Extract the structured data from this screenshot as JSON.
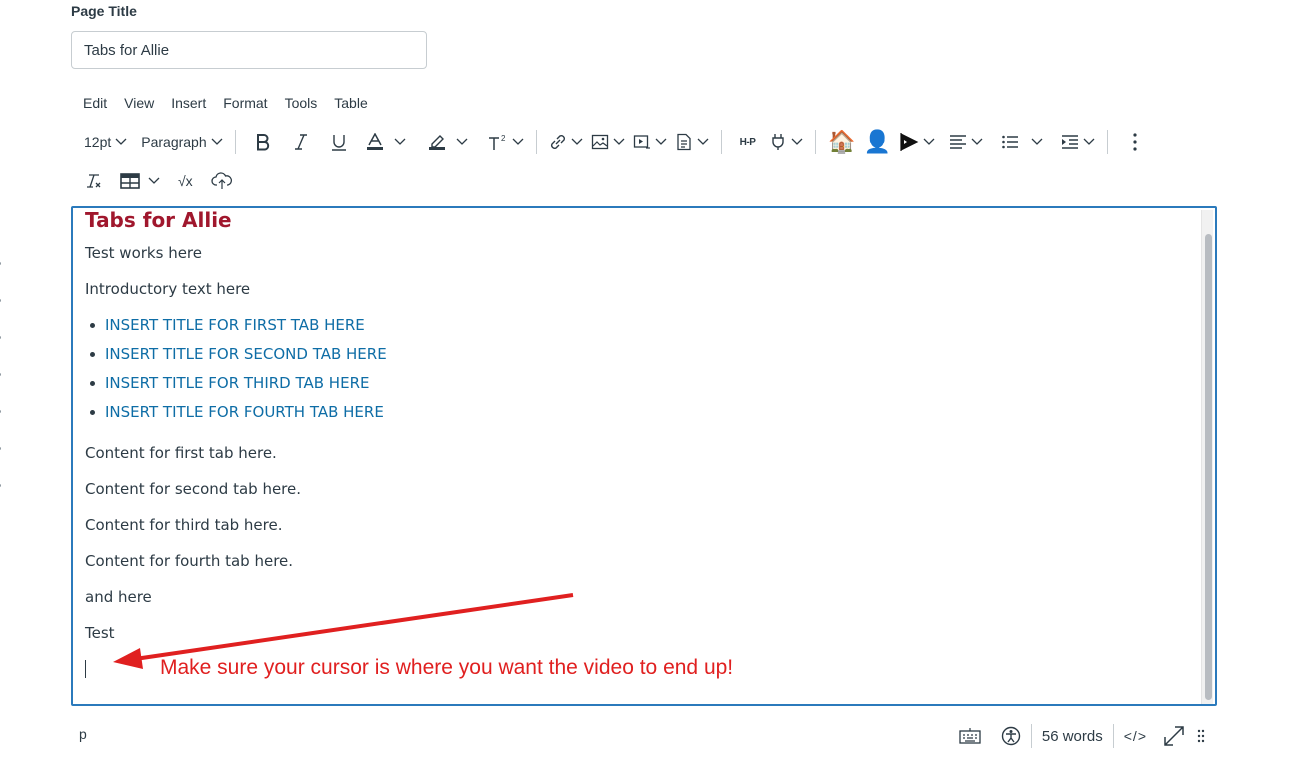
{
  "page_title": {
    "label": "Page Title",
    "value": "Tabs for Allie"
  },
  "menubar": [
    "Edit",
    "View",
    "Insert",
    "Format",
    "Tools",
    "Table"
  ],
  "toolbar": {
    "font_size": "12pt",
    "block_format": "Paragraph",
    "icons": [
      "bold-icon",
      "italic-icon",
      "underline-icon",
      "text-color-icon",
      "highlight-icon",
      "superscript-icon",
      "link-icon",
      "image-icon",
      "media-icon",
      "document-icon",
      "h5p-icon",
      "plugin-icon",
      "house-emoji-icon",
      "user-emoji-icon",
      "flag-icon",
      "align-icon",
      "list-icon",
      "indent-icon",
      "more-icon",
      "clear-format-icon",
      "table-icon",
      "math-icon",
      "cloud-icon"
    ],
    "h5p_label": "H-P",
    "math_label": "√x",
    "house_emoji": "🏠",
    "user_emoji": "👤"
  },
  "editor": {
    "heading": "Tabs for Allie",
    "paragraphs_top": [
      "Test works here",
      "Introductory text here"
    ],
    "tab_links": [
      "INSERT TITLE FOR FIRST TAB HERE",
      "INSERT TITLE FOR SECOND TAB HERE",
      "INSERT TITLE FOR THIRD TAB HERE",
      "INSERT TITLE FOR FOURTH TAB HERE"
    ],
    "paragraphs_bottom": [
      "Content for first tab here.",
      "Content for second tab here.",
      "Content for third tab here.",
      "Content for fourth tab here.",
      "and here",
      "Test"
    ]
  },
  "annotation": {
    "text": "Make sure your cursor is where you want the video to end up!",
    "color": "#e02020"
  },
  "statusbar": {
    "path": "p",
    "word_count": "56 words",
    "code_label": "</>"
  },
  "colors": {
    "heading": "#a0172d",
    "link": "#0e6da6",
    "focus_border": "#2b7abc"
  }
}
